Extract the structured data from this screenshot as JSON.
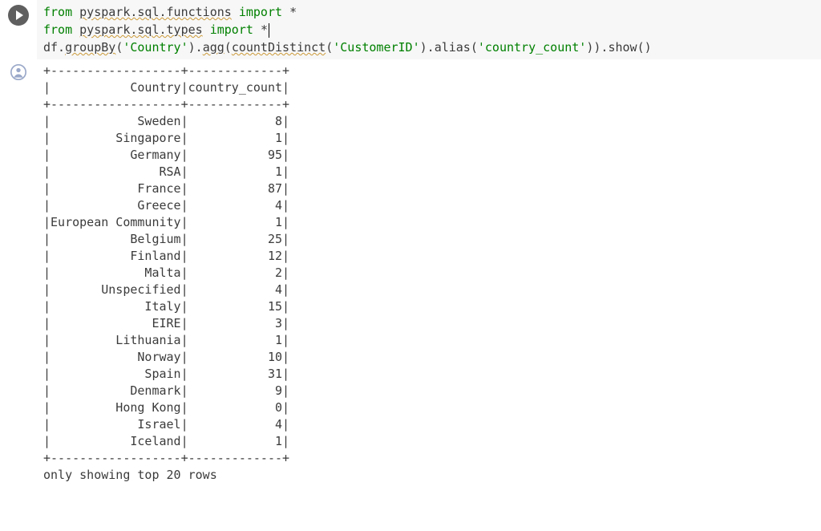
{
  "code": {
    "line1_from": "from",
    "line1_module": "pyspark.sql.functions",
    "line1_import": "import",
    "line1_star": "*",
    "line2_from": "from",
    "line2_module": "pyspark.sql.types",
    "line2_import": "import",
    "line2_star": "*",
    "line3_pre": "df.",
    "line3_groupBy": "groupBy",
    "line3_p1": "(",
    "line3_arg1": "'Country'",
    "line3_p2": ").",
    "line3_agg": "agg",
    "line3_p3": "(",
    "line3_countDistinct": "countDistinct",
    "line3_p4": "(",
    "line3_arg2": "'CustomerID'",
    "line3_p5": ").",
    "line3_alias": "alias",
    "line3_p6": "(",
    "line3_arg3": "'country_count'",
    "line3_p7": ")).",
    "line3_show": "show",
    "line3_p8": "()"
  },
  "output": {
    "sep": "+------------------+-------------+",
    "header": "|           Country|country_count|",
    "footer": "only showing top 20 rows",
    "rows": [
      "|            Sweden|            8|",
      "|         Singapore|            1|",
      "|           Germany|           95|",
      "|               RSA|            1|",
      "|            France|           87|",
      "|            Greece|            4|",
      "|European Community|            1|",
      "|           Belgium|           25|",
      "|           Finland|           12|",
      "|             Malta|            2|",
      "|       Unspecified|            4|",
      "|             Italy|           15|",
      "|              EIRE|            3|",
      "|         Lithuania|            1|",
      "|            Norway|           10|",
      "|             Spain|           31|",
      "|           Denmark|            9|",
      "|         Hong Kong|            0|",
      "|            Israel|            4|",
      "|           Iceland|            1|"
    ]
  },
  "chart_data": {
    "type": "table",
    "title": "country_count by Country",
    "columns": [
      "Country",
      "country_count"
    ],
    "rows": [
      [
        "Sweden",
        8
      ],
      [
        "Singapore",
        1
      ],
      [
        "Germany",
        95
      ],
      [
        "RSA",
        1
      ],
      [
        "France",
        87
      ],
      [
        "Greece",
        4
      ],
      [
        "European Community",
        1
      ],
      [
        "Belgium",
        25
      ],
      [
        "Finland",
        12
      ],
      [
        "Malta",
        2
      ],
      [
        "Unspecified",
        4
      ],
      [
        "Italy",
        15
      ],
      [
        "EIRE",
        3
      ],
      [
        "Lithuania",
        1
      ],
      [
        "Norway",
        10
      ],
      [
        "Spain",
        31
      ],
      [
        "Denmark",
        9
      ],
      [
        "Hong Kong",
        0
      ],
      [
        "Israel",
        4
      ],
      [
        "Iceland",
        1
      ]
    ],
    "note": "only showing top 20 rows"
  }
}
